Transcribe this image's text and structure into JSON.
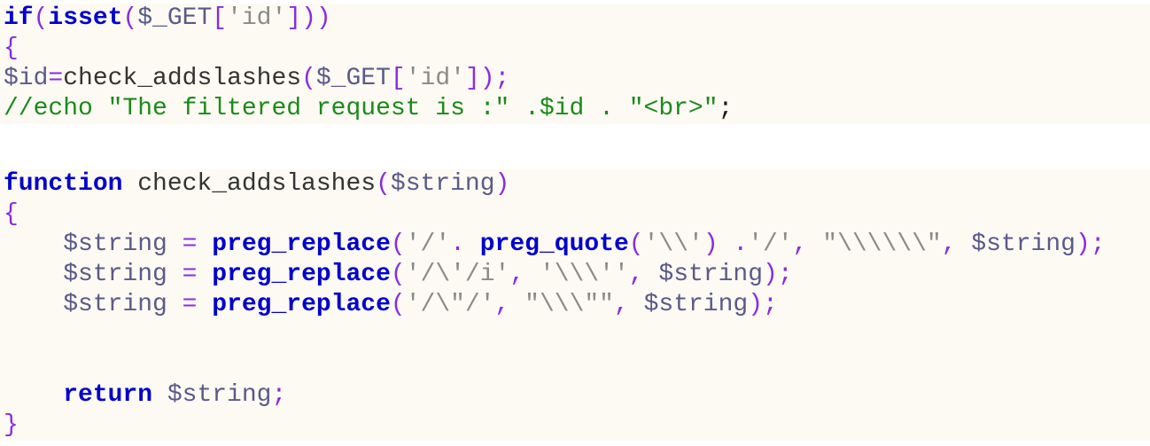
{
  "lines": [
    {
      "tokens": [
        {
          "t": "if",
          "c": "kw"
        },
        {
          "t": "(",
          "c": "punc"
        },
        {
          "t": "isset",
          "c": "kw"
        },
        {
          "t": "(",
          "c": "punc"
        },
        {
          "t": "$_GET",
          "c": "var"
        },
        {
          "t": "[",
          "c": "punc"
        },
        {
          "t": "'id'",
          "c": "str"
        },
        {
          "t": "]))",
          "c": "punc"
        }
      ]
    },
    {
      "tokens": [
        {
          "t": "{",
          "c": "punc"
        }
      ]
    },
    {
      "tokens": [
        {
          "t": "$id",
          "c": "var"
        },
        {
          "t": "=",
          "c": "punc"
        },
        {
          "t": "check_addslashes",
          "c": "plain"
        },
        {
          "t": "(",
          "c": "punc"
        },
        {
          "t": "$_GET",
          "c": "var"
        },
        {
          "t": "[",
          "c": "punc"
        },
        {
          "t": "'id'",
          "c": "str"
        },
        {
          "t": "]);",
          "c": "punc"
        }
      ]
    },
    {
      "tokens": [
        {
          "t": "//echo \"The filtered request is :\" .$id . \"<br>\"",
          "c": "cmt"
        },
        {
          "t": ";",
          "c": "semi"
        }
      ]
    },
    {
      "tokens": []
    },
    {
      "tokens": [
        {
          "t": "function",
          "c": "kw"
        },
        {
          "t": " check_addslashes",
          "c": "plain"
        },
        {
          "t": "(",
          "c": "punc"
        },
        {
          "t": "$string",
          "c": "var"
        },
        {
          "t": ")",
          "c": "punc"
        }
      ]
    },
    {
      "tokens": [
        {
          "t": "{",
          "c": "punc"
        }
      ]
    },
    {
      "tokens": [
        {
          "t": "    $string ",
          "c": "var"
        },
        {
          "t": "=",
          "c": "punc"
        },
        {
          "t": " ",
          "c": "plain"
        },
        {
          "t": "preg_replace",
          "c": "kw"
        },
        {
          "t": "(",
          "c": "punc"
        },
        {
          "t": "'/'",
          "c": "str"
        },
        {
          "t": ". ",
          "c": "punc"
        },
        {
          "t": "preg_quote",
          "c": "kw"
        },
        {
          "t": "(",
          "c": "punc"
        },
        {
          "t": "'\\\\'",
          "c": "str"
        },
        {
          "t": ") .",
          "c": "punc"
        },
        {
          "t": "'/'",
          "c": "str"
        },
        {
          "t": ", ",
          "c": "punc"
        },
        {
          "t": "\"\\\\\\\\\\\\\"",
          "c": "str"
        },
        {
          "t": ", ",
          "c": "punc"
        },
        {
          "t": "$string",
          "c": "var"
        },
        {
          "t": ");",
          "c": "punc"
        }
      ]
    },
    {
      "tokens": [
        {
          "t": "    $string ",
          "c": "var"
        },
        {
          "t": "=",
          "c": "punc"
        },
        {
          "t": " ",
          "c": "plain"
        },
        {
          "t": "preg_replace",
          "c": "kw"
        },
        {
          "t": "(",
          "c": "punc"
        },
        {
          "t": "'/\\'/i'",
          "c": "str"
        },
        {
          "t": ", ",
          "c": "punc"
        },
        {
          "t": "'\\\\\\''",
          "c": "str"
        },
        {
          "t": ", ",
          "c": "punc"
        },
        {
          "t": "$string",
          "c": "var"
        },
        {
          "t": ");",
          "c": "punc"
        }
      ]
    },
    {
      "tokens": [
        {
          "t": "    $string ",
          "c": "var"
        },
        {
          "t": "=",
          "c": "punc"
        },
        {
          "t": " ",
          "c": "plain"
        },
        {
          "t": "preg_replace",
          "c": "kw"
        },
        {
          "t": "(",
          "c": "punc"
        },
        {
          "t": "'/\\\"/'",
          "c": "str"
        },
        {
          "t": ", ",
          "c": "punc"
        },
        {
          "t": "\"\\\\\\\"\"",
          "c": "str"
        },
        {
          "t": ", ",
          "c": "punc"
        },
        {
          "t": "$string",
          "c": "var"
        },
        {
          "t": ");",
          "c": "punc"
        }
      ]
    },
    {
      "tokens": []
    },
    {
      "tokens": []
    },
    {
      "tokens": [
        {
          "t": "    ",
          "c": "plain"
        },
        {
          "t": "return",
          "c": "kw"
        },
        {
          "t": " $string",
          "c": "var"
        },
        {
          "t": ";",
          "c": "punc"
        }
      ]
    },
    {
      "tokens": [
        {
          "t": "}",
          "c": "punc"
        }
      ]
    }
  ]
}
